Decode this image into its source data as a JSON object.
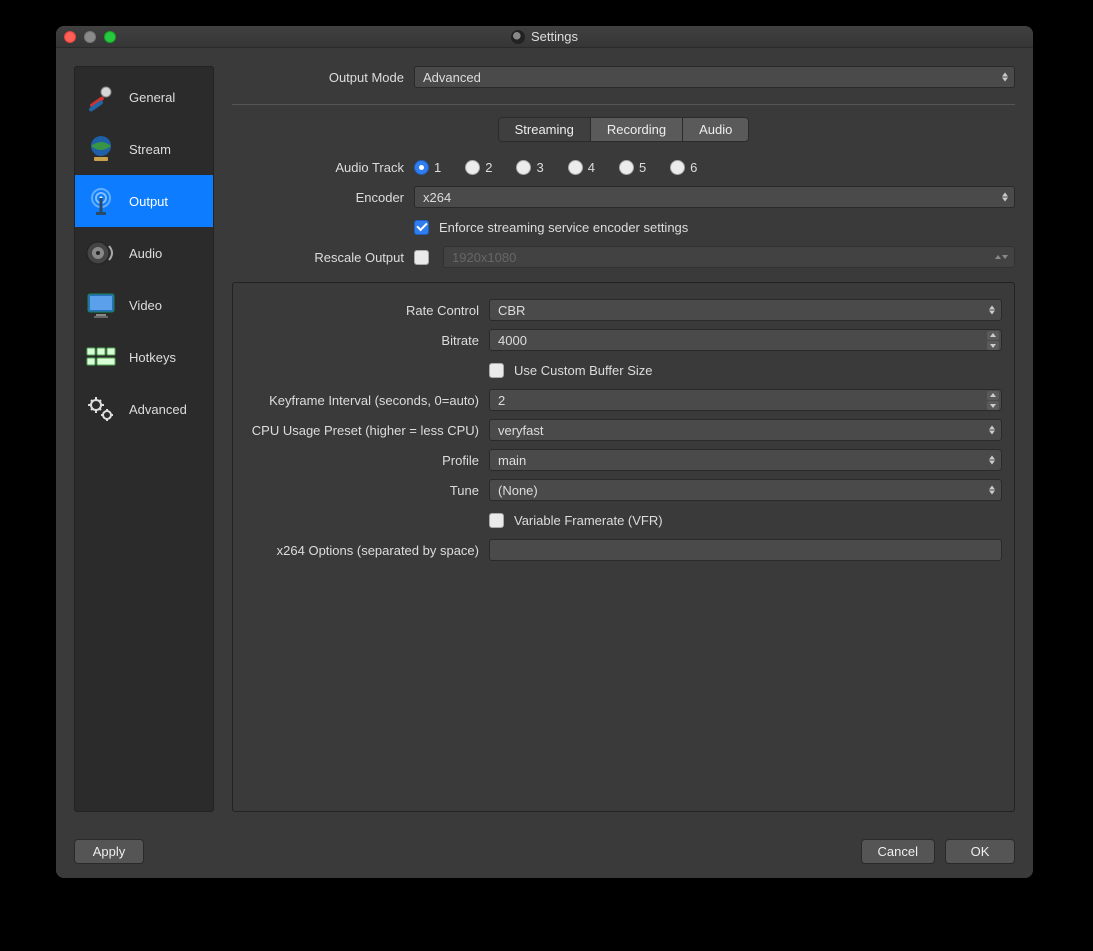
{
  "window": {
    "title": "Settings"
  },
  "sidebar": {
    "items": [
      {
        "label": "General"
      },
      {
        "label": "Stream"
      },
      {
        "label": "Output"
      },
      {
        "label": "Audio"
      },
      {
        "label": "Video"
      },
      {
        "label": "Hotkeys"
      },
      {
        "label": "Advanced"
      }
    ]
  },
  "topbar": {
    "output_mode_label": "Output Mode",
    "output_mode_value": "Advanced"
  },
  "tabs": {
    "streaming": "Streaming",
    "recording": "Recording",
    "audio": "Audio"
  },
  "streaming": {
    "audio_track_label": "Audio Track",
    "audio_track_options": [
      "1",
      "2",
      "3",
      "4",
      "5",
      "6"
    ],
    "audio_track_selected": "1",
    "encoder_label": "Encoder",
    "encoder_value": "x264",
    "enforce_label": "Enforce streaming service encoder settings",
    "rescale_label": "Rescale Output",
    "rescale_placeholder": "1920x1080"
  },
  "x264": {
    "rate_control_label": "Rate Control",
    "rate_control_value": "CBR",
    "bitrate_label": "Bitrate",
    "bitrate_value": "4000",
    "custom_buffer_label": "Use Custom Buffer Size",
    "keyframe_label": "Keyframe Interval (seconds, 0=auto)",
    "keyframe_value": "2",
    "cpu_preset_label": "CPU Usage Preset (higher = less CPU)",
    "cpu_preset_value": "veryfast",
    "profile_label": "Profile",
    "profile_value": "main",
    "tune_label": "Tune",
    "tune_value": "(None)",
    "vfr_label": "Variable Framerate (VFR)",
    "x264opts_label": "x264 Options (separated by space)",
    "x264opts_value": ""
  },
  "footer": {
    "apply": "Apply",
    "cancel": "Cancel",
    "ok": "OK"
  }
}
